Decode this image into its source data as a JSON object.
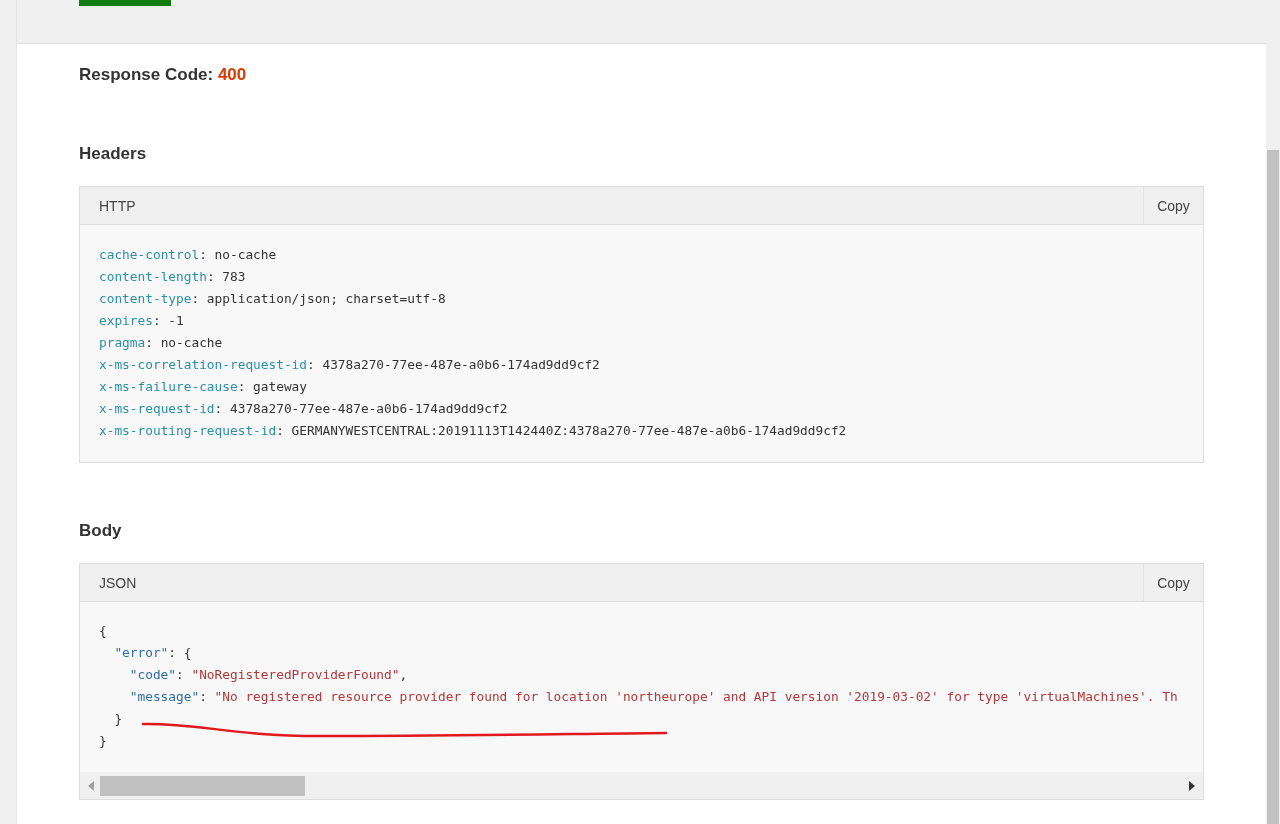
{
  "response": {
    "label": "Response Code:",
    "code": "400"
  },
  "sections": [
    {
      "title": "Headers",
      "block": {
        "label": "HTTP",
        "copy": "Copy",
        "horizontal_scrollbar": false,
        "lines": [
          {
            "tokens": [
              {
                "kind": "key",
                "text": "cache-control"
              },
              {
                "kind": "plain",
                "text": ": no-cache"
              }
            ]
          },
          {
            "tokens": [
              {
                "kind": "key",
                "text": "content-length"
              },
              {
                "kind": "plain",
                "text": ": 783"
              }
            ]
          },
          {
            "tokens": [
              {
                "kind": "key",
                "text": "content-type"
              },
              {
                "kind": "plain",
                "text": ": application/json; charset=utf-8"
              }
            ]
          },
          {
            "tokens": [
              {
                "kind": "key",
                "text": "expires"
              },
              {
                "kind": "plain",
                "text": ": -1"
              }
            ]
          },
          {
            "tokens": [
              {
                "kind": "key",
                "text": "pragma"
              },
              {
                "kind": "plain",
                "text": ": no-cache"
              }
            ]
          },
          {
            "tokens": [
              {
                "kind": "key",
                "text": "x-ms-correlation-request-id"
              },
              {
                "kind": "plain",
                "text": ": 4378a270-77ee-487e-a0b6-174ad9dd9cf2"
              }
            ]
          },
          {
            "tokens": [
              {
                "kind": "key",
                "text": "x-ms-failure-cause"
              },
              {
                "kind": "plain",
                "text": ": gateway"
              }
            ]
          },
          {
            "tokens": [
              {
                "kind": "key",
                "text": "x-ms-request-id"
              },
              {
                "kind": "plain",
                "text": ": 4378a270-77ee-487e-a0b6-174ad9dd9cf2"
              }
            ]
          },
          {
            "tokens": [
              {
                "kind": "key",
                "text": "x-ms-routing-request-id"
              },
              {
                "kind": "plain",
                "text": ": GERMANYWESTCENTRAL:20191113T142440Z:4378a270-77ee-487e-a0b6-174ad9dd9cf2"
              }
            ]
          }
        ]
      }
    },
    {
      "title": "Body",
      "block": {
        "label": "JSON",
        "copy": "Copy",
        "horizontal_scrollbar": true,
        "lines": [
          {
            "tokens": [
              {
                "kind": "plain",
                "text": "{"
              }
            ],
            "children": [
              {
                "tokens": [
                  {
                    "kind": "jsonkey",
                    "text": "\"error\""
                  },
                  {
                    "kind": "plain",
                    "text": ": {"
                  }
                ],
                "children": [
                  {
                    "tokens": [
                      {
                        "kind": "jsonkey",
                        "text": "\"code\""
                      },
                      {
                        "kind": "plain",
                        "text": ": "
                      },
                      {
                        "kind": "string",
                        "text": "\"NoRegisteredProviderFound\""
                      },
                      {
                        "kind": "plain",
                        "text": ","
                      }
                    ]
                  },
                  {
                    "tokens": [
                      {
                        "kind": "jsonkey",
                        "text": "\"message\""
                      },
                      {
                        "kind": "plain",
                        "text": ": "
                      },
                      {
                        "kind": "string",
                        "text": "\"No registered resource provider found for location 'northeurope' and API version '2019-03-02' for type 'virtualMachines'. Th"
                      }
                    ]
                  }
                ]
              },
              {
                "tokens": [
                  {
                    "kind": "plain",
                    "text": "}"
                  }
                ]
              }
            ]
          },
          {
            "tokens": [
              {
                "kind": "plain",
                "text": "}"
              }
            ]
          }
        ]
      }
    }
  ]
}
